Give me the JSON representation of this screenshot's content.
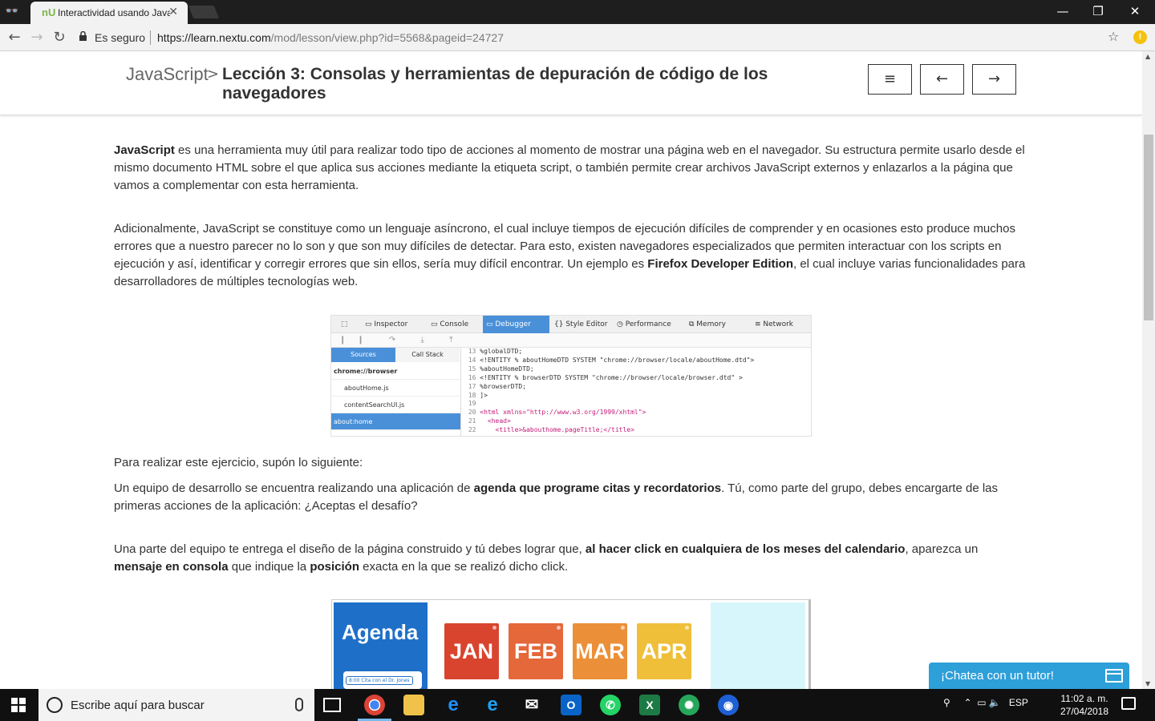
{
  "browser": {
    "tab_title": "Interactividad usando JavaScript",
    "tab_favicon": "nU",
    "secure_label": "Es seguro",
    "url_host": "https://learn.nextu.com",
    "url_path": "/mod/lesson/view.php?id=5568&pageid=24727",
    "buttons": {
      "minimize": "—",
      "maximize": "❐",
      "close": "✕",
      "back": "←",
      "forward": "→",
      "reload": "↻",
      "star": "☆",
      "ext": "!"
    }
  },
  "header": {
    "breadcrumb": "JavaScript",
    "separator": ">",
    "lesson_title": "Lección 3: Consolas y herramientas de depuración de código de los navegadores",
    "menu_button": "≡",
    "prev_button": "←",
    "next_button": "→"
  },
  "content": {
    "p1_bold": "JavaScript",
    "p1_rest": " es una herramienta muy útil para realizar todo tipo de acciones al momento de mostrar una página web en el navegador. Su estructura permite usarlo desde el mismo documento HTML sobre el que aplica sus acciones mediante la etiqueta script, o también permite crear archivos JavaScript externos y enlazarlos a la página que vamos a complementar con esta herramienta.",
    "p2_a": "Adicionalmente, JavaScript se constituye como un lenguaje asíncrono, el cual incluye tiempos de ejecución difíciles de comprender y en ocasiones esto produce muchos errores que a nuestro parecer no lo son y que son muy difíciles de detectar. Para esto, existen navegadores especializados que permiten interactuar con los scripts en ejecución y así, identificar y corregir errores que sin ellos, sería muy difícil encontrar. Un ejemplo es ",
    "p2_bold": "Firefox Developer Edition",
    "p2_b": ", el cual incluye varias funcionalidades para desarrolladores de múltiples tecnologías web.",
    "p3": "Para realizar este ejercicio, supón lo siguiente:",
    "p4_a": "Un equipo de desarrollo se encuentra realizando una aplicación de ",
    "p4_bold": "agenda que programe citas y recordatorios",
    "p4_b": ". Tú, como parte del grupo, debes encargarte de las primeras acciones de la aplicación: ¿Aceptas el desafío?",
    "p5_a": "Una parte del equipo te entrega el diseño de la página construido y tú debes lograr que, ",
    "p5_bold1": "al hacer click en cualquiera de los meses del calendario",
    "p5_b": ", aparezca un ",
    "p5_bold2": "mensaje en consola",
    "p5_c": " que indique la ",
    "p5_bold3": "posición",
    "p5_d": " exacta en la que se realizó dicho click."
  },
  "devtools": {
    "tabs": [
      "Inspector",
      "Console",
      "Debugger",
      "Style Editor",
      "Performance",
      "Memory",
      "Network"
    ],
    "active_tab": "Debugger",
    "controls": "❙❙ ↷ ⤓ ⤒",
    "source_tabs": [
      "Sources",
      "Call Stack"
    ],
    "source_items": [
      "chrome://browser",
      "aboutHome.js",
      "contentSearchUI.js",
      "about:home"
    ],
    "code_lines": [
      {
        "n": "13",
        "t": "%globalDTD;"
      },
      {
        "n": "14",
        "t": "<!ENTITY % aboutHomeDTD SYSTEM \"chrome://browser/locale/aboutHome.dtd\">"
      },
      {
        "n": "15",
        "t": "%aboutHomeDTD;"
      },
      {
        "n": "16",
        "t": "<!ENTITY % browserDTD SYSTEM \"chrome://browser/locale/browser.dtd\" >"
      },
      {
        "n": "17",
        "t": "%browserDTD;"
      },
      {
        "n": "18",
        "t": "]>"
      },
      {
        "n": "19",
        "t": ""
      },
      {
        "n": "20",
        "t": "<html xmlns=\"http://www.w3.org/1999/xhtml\">"
      },
      {
        "n": "21",
        "t": "  <head>"
      },
      {
        "n": "22",
        "t": "    <title>&abouthome.pageTitle;</title>"
      }
    ]
  },
  "agenda": {
    "title": "Agenda",
    "appointment": "8:00 Cita con el Dr. Jones",
    "months": [
      {
        "label": "JAN",
        "color": "#d9442e"
      },
      {
        "label": "FEB",
        "color": "#e4683a"
      },
      {
        "label": "MAR",
        "color": "#eb9038"
      },
      {
        "label": "APR",
        "color": "#efbf3a"
      }
    ]
  },
  "chat": {
    "label": "¡Chatea con un tutor!"
  },
  "taskbar": {
    "search_placeholder": "Escribe aquí para buscar",
    "language": "ESP",
    "time": "11:02 a. m.",
    "date": "27/04/2018"
  }
}
